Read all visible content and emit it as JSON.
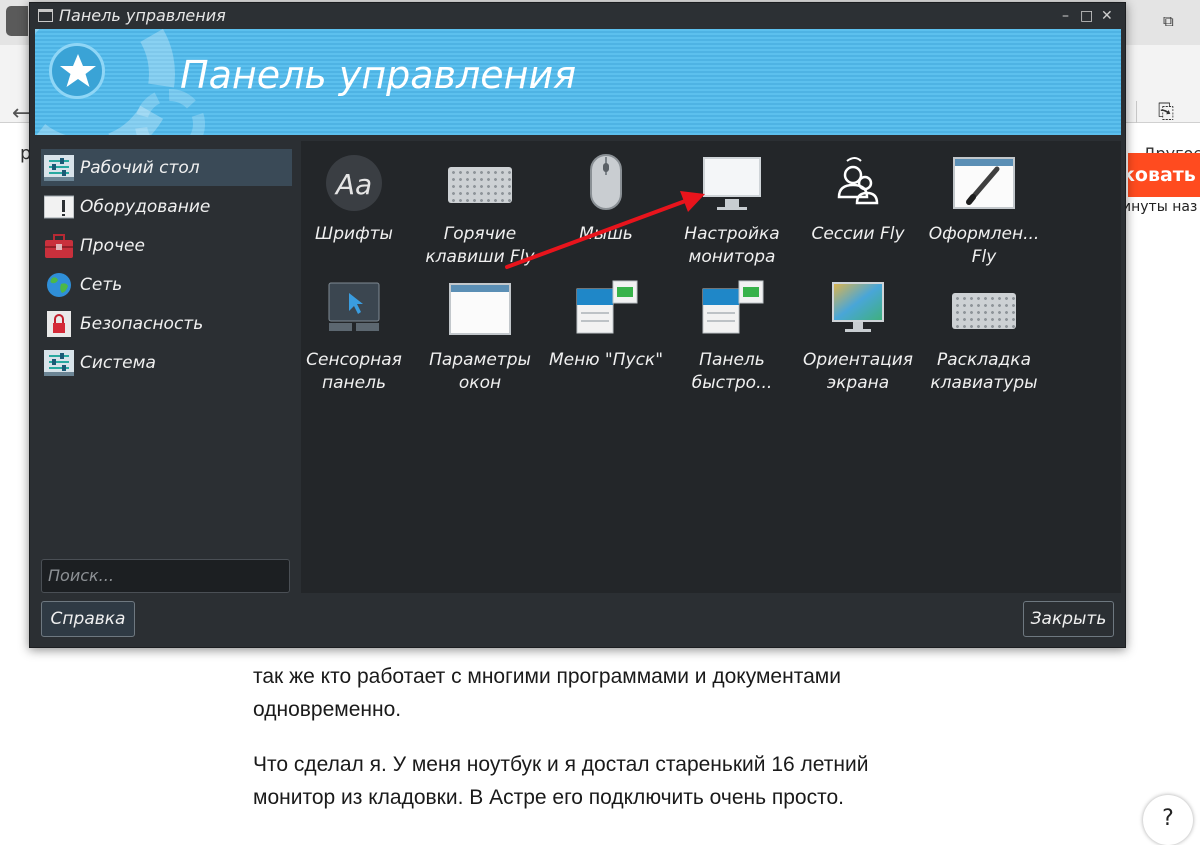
{
  "browser": {
    "other_bookmarks": "Другое",
    "left_fragment": "р",
    "publish_button": "ковать",
    "time_ago": "инуты наз"
  },
  "article": {
    "para1_line1": "так же кто работает с многими программами и документами",
    "para1_line2": "одновременно.",
    "para2_line1": "Что сделал я. У меня ноутбук и я достал старенький 16 летний",
    "para2_line2": "монитор из кладовки. В Астре его подключить очень просто.",
    "help_label": "?"
  },
  "dialog": {
    "title": "Панель управления",
    "banner_title": "Панель управления",
    "controls": {
      "minimize": "–",
      "maximize": "□",
      "close": "✕"
    },
    "sidebar": [
      {
        "label": "Рабочий стол",
        "icon": "desktop-sliders-icon",
        "active": true
      },
      {
        "label": "Оборудование",
        "icon": "hardware-panel-icon",
        "active": false
      },
      {
        "label": "Прочее",
        "icon": "toolbox-icon",
        "active": false
      },
      {
        "label": "Сеть",
        "icon": "globe-icon",
        "active": false
      },
      {
        "label": "Безопасность",
        "icon": "lock-icon",
        "active": false
      },
      {
        "label": "Система",
        "icon": "system-sliders-icon",
        "active": false
      }
    ],
    "search_placeholder": "Поиск...",
    "help_button": "Справка",
    "close_button": "Закрыть",
    "tiles": [
      {
        "line1": "Шрифты",
        "line2": "",
        "icon": "fonts-icon"
      },
      {
        "line1": "Горячие",
        "line2": "клавиши Fly",
        "icon": "keyboard-icon"
      },
      {
        "line1": "Мышь",
        "line2": "",
        "icon": "mouse-icon"
      },
      {
        "line1": "Настройка",
        "line2": "монитора",
        "icon": "monitor-icon"
      },
      {
        "line1": "Сессии Fly",
        "line2": "",
        "icon": "sessions-icon"
      },
      {
        "line1": "Оформлен...",
        "line2": "Fly",
        "icon": "theme-brush-icon"
      },
      {
        "line1": "Сенсорная",
        "line2": "панель",
        "icon": "touchpad-icon"
      },
      {
        "line1": "Параметры",
        "line2": "окон",
        "icon": "window-settings-icon"
      },
      {
        "line1": "Меню \"Пуск\"",
        "line2": "",
        "icon": "start-menu-icon"
      },
      {
        "line1": "Панель",
        "line2": "быстро...",
        "icon": "quick-panel-icon"
      },
      {
        "line1": "Ориентация",
        "line2": "экрана",
        "icon": "screen-orientation-icon"
      },
      {
        "line1": "Раскладка",
        "line2": "клавиатуры",
        "icon": "keyboard-layout-icon"
      }
    ]
  },
  "colors": {
    "annotation_arrow": "#e8141c",
    "accent_blue": "#5cc0ee",
    "publish_orange": "#ff4b1f"
  }
}
